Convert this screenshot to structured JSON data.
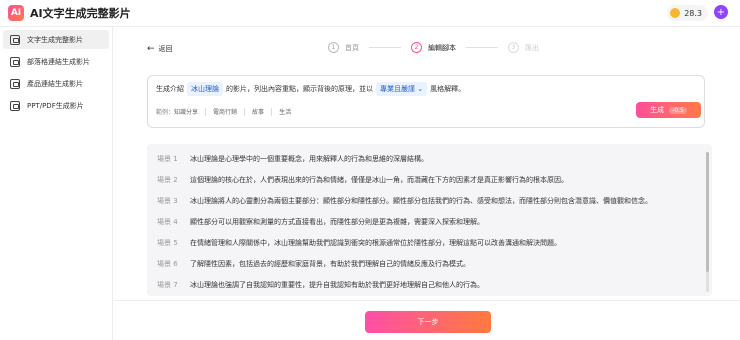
{
  "app": {
    "title": "AI文字生成完整影片",
    "logo_text": "AI"
  },
  "credits": {
    "value": "28.3",
    "plus": "+"
  },
  "sidebar": {
    "items": [
      {
        "label": "文字生成完整影片",
        "icon": "text-video-icon"
      },
      {
        "label": "部落格連結生成影片",
        "icon": "blog-link-icon"
      },
      {
        "label": "產品連結生成影片",
        "icon": "product-link-icon"
      },
      {
        "label": "PPT/PDF生成影片",
        "icon": "document-icon"
      }
    ]
  },
  "nav": {
    "back_label": "返回"
  },
  "steps": [
    {
      "num": "1",
      "label": "首頁"
    },
    {
      "num": "2",
      "label": "編輯腳本"
    },
    {
      "num": "3",
      "label": "匯出"
    }
  ],
  "prompt": {
    "pre": "生成介紹",
    "topic": "冰山理論",
    "mid": "的影片，列出內容重點，顯示背後的原理，並以",
    "style": "專業且嚴謹 ⌄",
    "post": "風格解釋。",
    "examples_label": "範例：",
    "examples": [
      "知識分享",
      "電商行銷",
      "故事",
      "生活"
    ],
    "generate_label": "生成",
    "generate_cost": "-0.5"
  },
  "scenes": [
    {
      "label": "場景 1",
      "text": "冰山理論是心理學中的一個重要概念，用來解釋人的行為和思維的深層結構。"
    },
    {
      "label": "場景 2",
      "text": "這個理論的核心在於，人們表現出來的行為和情緒，僅僅是冰山一角，而潛藏在下方的因素才是真正影響行為的根本原因。"
    },
    {
      "label": "場景 3",
      "text": "冰山理論將人的心靈劃分為兩個主要部分：顯性部分和隱性部分。顯性部分包括我們的行為、感受和想法，而隱性部分則包含潛意識、價值觀和信念。"
    },
    {
      "label": "場景 4",
      "text": "顯性部分可以用觀察和測量的方式直接看出，而隱性部分則是更為複雜，需要深入探索和理解。"
    },
    {
      "label": "場景 5",
      "text": "在情緒管理和人際關係中，冰山理論幫助我們認識到衝突的根源通常位於隱性部分，理解這點可以改善溝通和解決問題。"
    },
    {
      "label": "場景 6",
      "text": "了解隱性因素，包括過去的經歷和家庭背景，有助於我們理解自己的情緒反應及行為模式。"
    },
    {
      "label": "場景 7",
      "text": "冰山理論也強調了自我認知的重要性，提升自我認知有助於我們更好地理解自己和他人的行為。"
    }
  ],
  "footer": {
    "next_label": "下一步"
  },
  "colors": {
    "accent_start": "#ff4f9a",
    "accent_end": "#ff7a45",
    "chip_text": "#1a5fd4"
  }
}
